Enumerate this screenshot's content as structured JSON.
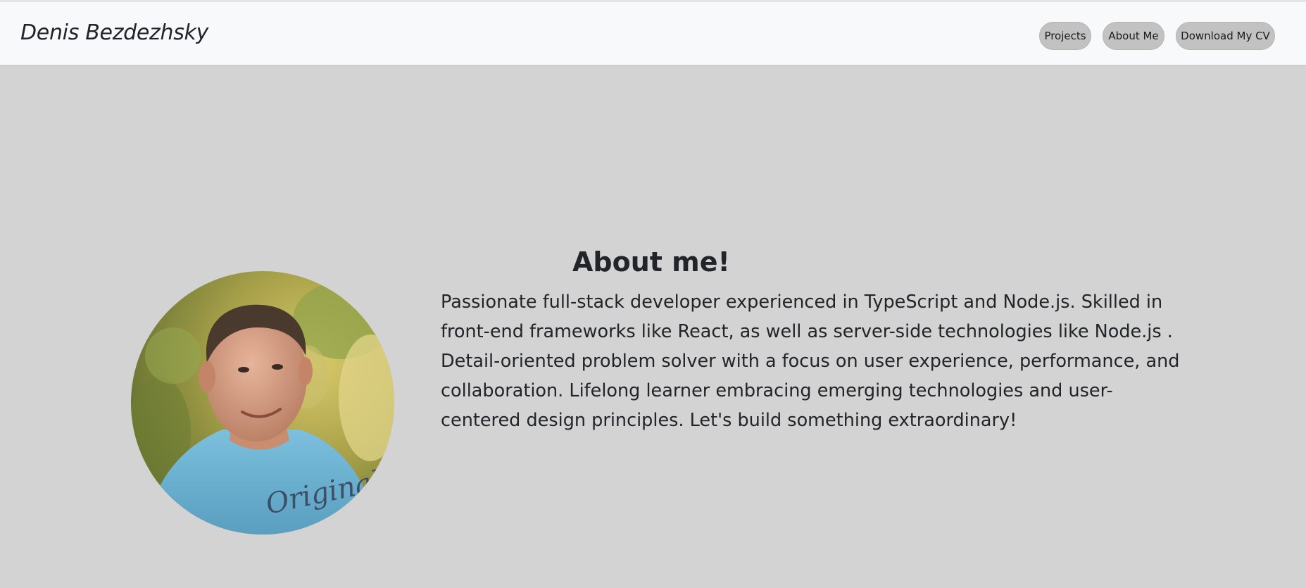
{
  "header": {
    "brand": "Denis Bezdezhsky",
    "nav": [
      {
        "label": "Projects"
      },
      {
        "label": "About Me"
      },
      {
        "label": "Download My CV"
      }
    ]
  },
  "about": {
    "title": "About me!",
    "body": "Passionate full-stack developer experienced in TypeScript and Node.js. Skilled in front-end frameworks like React, as well as server-side technologies like Node.js . Detail-oriented problem solver with a focus on user experience, performance, and collaboration. Lifelong learner embracing emerging technologies and user-centered design principles. Let's build something extraordinary!",
    "photo_shirt_text": "Originals"
  },
  "colors": {
    "page_background": "#d3d3d3",
    "header_background": "#f8f9fa",
    "nav_button_background": "#c2c2c2",
    "text": "#212529",
    "shirt": "#6fb3d2"
  }
}
